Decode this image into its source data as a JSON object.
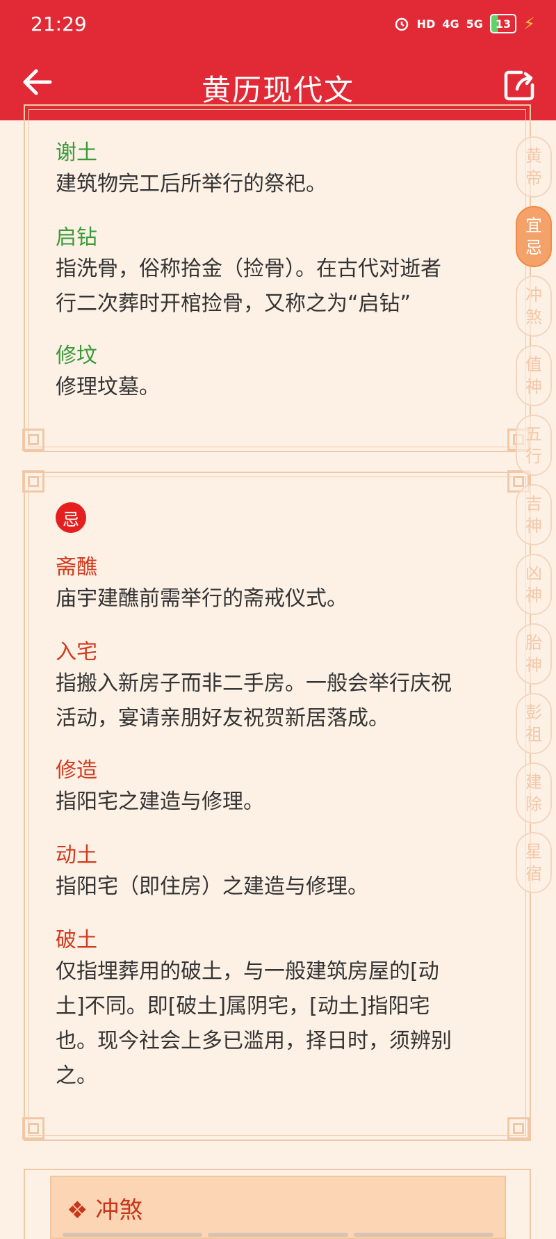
{
  "status_bar": {
    "time": "21:29",
    "hd": "HD",
    "net1": "4G",
    "net2": "5G",
    "battery": "13"
  },
  "header": {
    "title": "黄历现代文"
  },
  "yi_card": {
    "entries": [
      {
        "term": "谢土",
        "desc": [
          "建筑物完工后所举行的祭祀。"
        ]
      },
      {
        "term": "启钻",
        "desc": [
          "指洗骨，俗称拾金（捡骨）。在古代对逝者",
          "行二次葬时开棺捡骨，又称之为“启钻”"
        ]
      },
      {
        "term": "修坟",
        "desc": [
          "修理坟墓。"
        ]
      }
    ]
  },
  "ji_card": {
    "badge": "忌",
    "entries": [
      {
        "term": "斋醮",
        "desc": [
          "庙宇建醮前需举行的斋戒仪式。"
        ]
      },
      {
        "term": "入宅",
        "desc": [
          "指搬入新房子而非二手房。一般会举行庆祝",
          "活动，宴请亲朋好友祝贺新居落成。"
        ]
      },
      {
        "term": "修造",
        "desc": [
          "指阳宅之建造与修理。"
        ]
      },
      {
        "term": "动土",
        "desc": [
          "指阳宅（即住房）之建造与修理。"
        ]
      },
      {
        "term": "破土",
        "desc": [
          "仅指埋葬用的破土，与一般建筑房屋的[动",
          "土]不同。即[破土]属阴宅，[动土]指阳宅",
          "也。现今社会上多已滥用，择日时，须辨别",
          "之。"
        ]
      }
    ]
  },
  "side_nav": [
    {
      "line1": "黄",
      "line2": "帝",
      "active": false
    },
    {
      "line1": "宜",
      "line2": "忌",
      "active": true
    },
    {
      "line1": "冲",
      "line2": "煞",
      "active": false
    },
    {
      "line1": "值",
      "line2": "神",
      "active": false
    },
    {
      "line1": "五",
      "line2": "行",
      "active": false
    },
    {
      "line1": "吉",
      "line2": "神",
      "active": false
    },
    {
      "line1": "凶",
      "line2": "神",
      "active": false
    },
    {
      "line1": "胎",
      "line2": "神",
      "active": false
    },
    {
      "line1": "彭",
      "line2": "祖",
      "active": false
    },
    {
      "line1": "建",
      "line2": "除",
      "active": false
    },
    {
      "line1": "星",
      "line2": "宿",
      "active": false
    }
  ],
  "next_section": {
    "title": "❖ 冲煞"
  },
  "colors": {
    "header_bg": "#e22a36",
    "page_bg": "#fdf1e6",
    "yi_term": "#3a9a3a",
    "ji_term": "#d2391d",
    "nav_active": "#f4a269"
  }
}
